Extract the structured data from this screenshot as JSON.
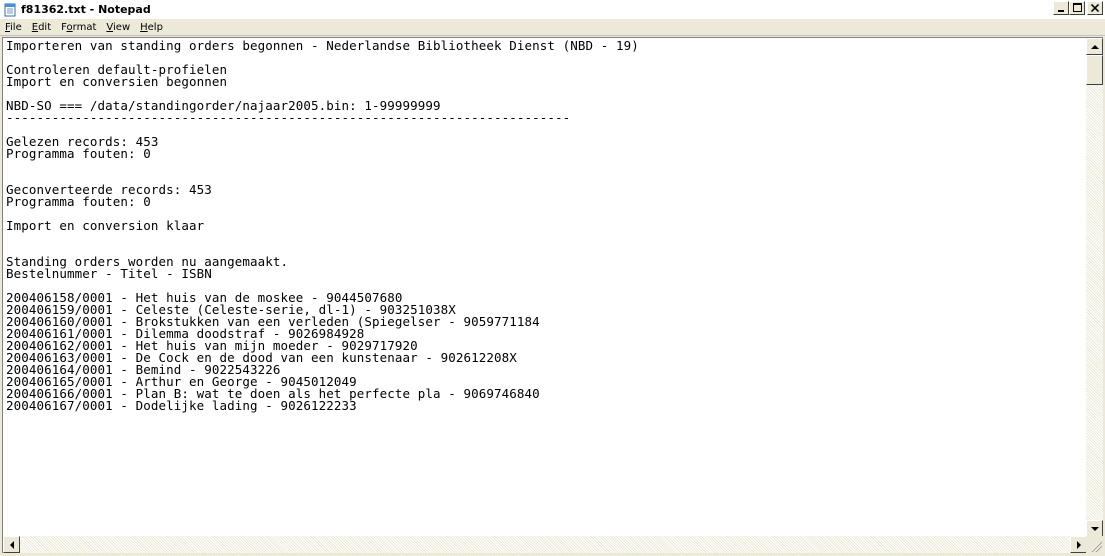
{
  "window": {
    "title": "f81362.txt - Notepad",
    "icon": "notepad-icon"
  },
  "caption_buttons": {
    "minimize_icon": "minimize-icon",
    "maximize_icon": "maximize-icon",
    "close_icon": "close-icon"
  },
  "menu": {
    "items": [
      {
        "underline": "F",
        "rest": "ile"
      },
      {
        "underline": "E",
        "rest": "dit"
      },
      {
        "pre": "F",
        "underline": "o",
        "rest": "rmat"
      },
      {
        "underline": "V",
        "rest": "iew"
      },
      {
        "underline": "H",
        "rest": "elp"
      }
    ]
  },
  "document": {
    "lines": [
      "Importeren van standing orders begonnen - Nederlandse Bibliotheek Dienst (NBD - 19)",
      "",
      "Controleren default-profielen",
      "Import en conversien begonnen",
      "",
      "NBD-SO === /data/standingorder/najaar2005.bin: 1-99999999",
      "--------------------------------------------------------------------------",
      "",
      "Gelezen records: 453",
      "Programma fouten: 0",
      "",
      "",
      "Geconverteerde records: 453",
      "Programma fouten: 0",
      "",
      "Import en conversion klaar",
      "",
      "",
      "Standing orders worden nu aangemaakt.",
      "Bestelnummer - Titel - ISBN",
      "",
      "200406158/0001 - Het huis van de moskee - 9044507680",
      "200406159/0001 - Celeste (Celeste-serie, dl-1) - 903251038X",
      "200406160/0001 - Brokstukken van een verleden (Spiegelser - 9059771184",
      "200406161/0001 - Dilemma doodstraf - 9026984928",
      "200406162/0001 - Het huis van mijn moeder - 9029717920",
      "200406163/0001 - De Cock en de dood van een kunstenaar - 902612208X",
      "200406164/0001 - Bemind - 9022543226",
      "200406165/0001 - Arthur en George - 9045012049",
      "200406166/0001 - Plan B: wat te doen als het perfecte pla - 9069746840",
      "200406167/0001 - Dodelijke lading - 9026122233"
    ]
  },
  "scrollbars": {
    "up_icon": "scroll-up-arrow-icon",
    "down_icon": "scroll-down-arrow-icon",
    "left_icon": "scroll-left-arrow-icon",
    "right_icon": "scroll-right-arrow-icon"
  }
}
